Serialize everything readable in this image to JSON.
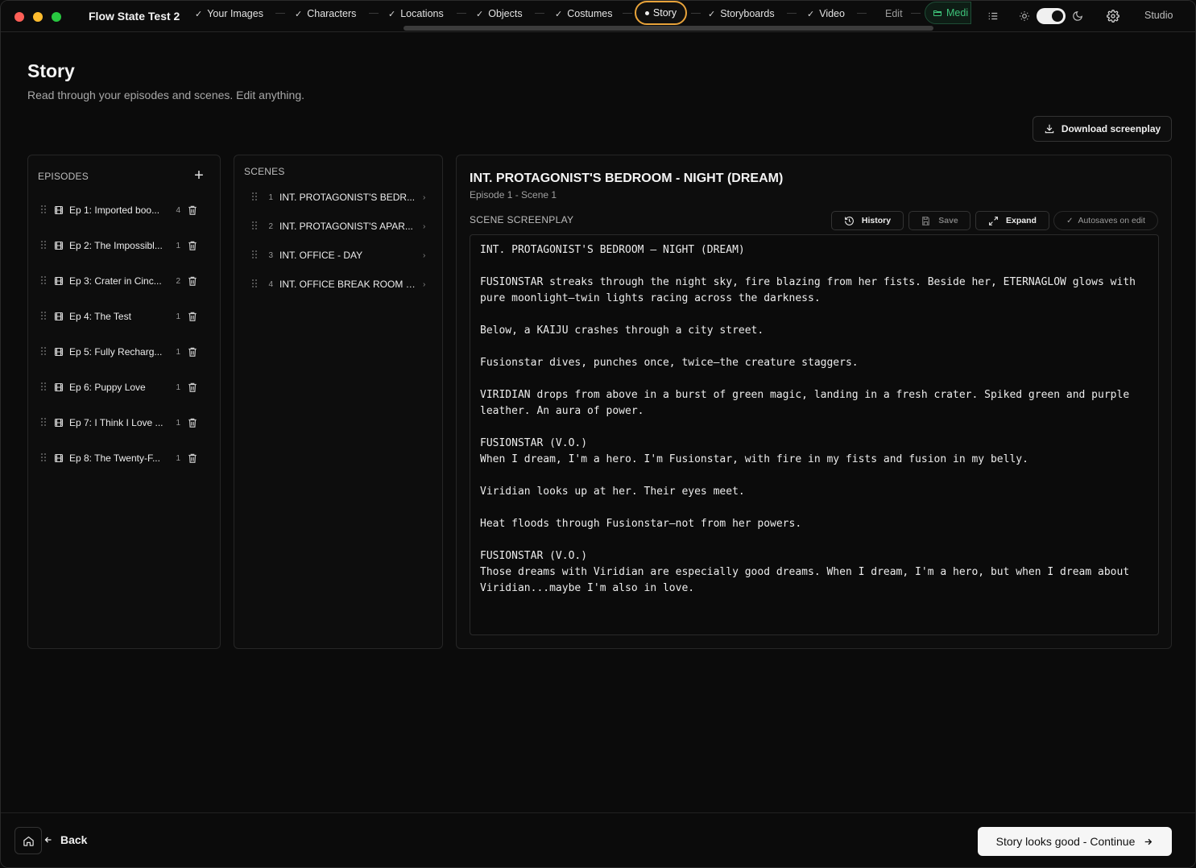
{
  "window": {
    "title": "Flow State Test 2"
  },
  "steps": [
    {
      "label": "Your Images",
      "done": true
    },
    {
      "label": "Characters",
      "done": true
    },
    {
      "label": "Locations",
      "done": true
    },
    {
      "label": "Objects",
      "done": true
    },
    {
      "label": "Costumes",
      "done": true
    },
    {
      "label": "Story",
      "active": true
    },
    {
      "label": "Storyboards",
      "done": true
    },
    {
      "label": "Video",
      "done": true
    },
    {
      "label": "Edit",
      "done": false
    },
    {
      "label": "Medi",
      "done": false
    }
  ],
  "toolbar": {
    "studio_label": "Studio",
    "theme_toggle": "on"
  },
  "page": {
    "title": "Story",
    "subtitle": "Read through your episodes and scenes. Edit anything.",
    "download_label": "Download screenplay"
  },
  "episodes": {
    "header": "EPISODES",
    "items": [
      {
        "name": "Ep 1: Imported boo...",
        "count": "4"
      },
      {
        "name": "Ep 2: The Impossibl...",
        "count": "1"
      },
      {
        "name": "Ep 3: Crater in Cinc...",
        "count": "2"
      },
      {
        "name": "Ep 4: The Test",
        "count": "1"
      },
      {
        "name": "Ep 5: Fully Recharg...",
        "count": "1"
      },
      {
        "name": "Ep 6: Puppy Love",
        "count": "1"
      },
      {
        "name": "Ep 7: I Think I Love ...",
        "count": "1"
      },
      {
        "name": "Ep 8: The Twenty-F...",
        "count": "1"
      }
    ]
  },
  "scenes": {
    "header": "SCENES",
    "items": [
      {
        "num": "1",
        "name": "INT. PROTAGONIST'S BEDR..."
      },
      {
        "num": "2",
        "name": "INT. PROTAGONIST'S APAR..."
      },
      {
        "num": "3",
        "name": "INT. OFFICE - DAY"
      },
      {
        "num": "4",
        "name": "INT. OFFICE BREAK ROOM -..."
      }
    ]
  },
  "detail": {
    "title": "INT. PROTAGONIST'S BEDROOM - NIGHT (DREAM)",
    "meta": "Episode 1 - Scene 1",
    "section_label": "SCENE SCREENPLAY",
    "history_label": "History",
    "save_label": "Save",
    "expand_label": "Expand",
    "autosave_label": "Autosaves on edit",
    "screenplay": "INT. PROTAGONIST'S BEDROOM – NIGHT (DREAM)\n\nFUSIONSTAR streaks through the night sky, fire blazing from her fists. Beside her, ETERNAGLOW glows with pure moonlight—twin lights racing across the darkness.\n\nBelow, a KAIJU crashes through a city street.\n\nFusionstar dives, punches once, twice—the creature staggers.\n\nVIRIDIAN drops from above in a burst of green magic, landing in a fresh crater. Spiked green and purple leather. An aura of power.\n\nFUSIONSTAR (V.O.)\nWhen I dream, I'm a hero. I'm Fusionstar, with fire in my fists and fusion in my belly.\n\nViridian looks up at her. Their eyes meet.\n\nHeat floods through Fusionstar—not from her powers.\n\nFUSIONSTAR (V.O.)\nThose dreams with Viridian are especially good dreams. When I dream, I'm a hero, but when I dream about Viridian...maybe I'm also in love."
  },
  "footer": {
    "back_label": "Back",
    "continue_label": "Story looks good - Continue"
  }
}
